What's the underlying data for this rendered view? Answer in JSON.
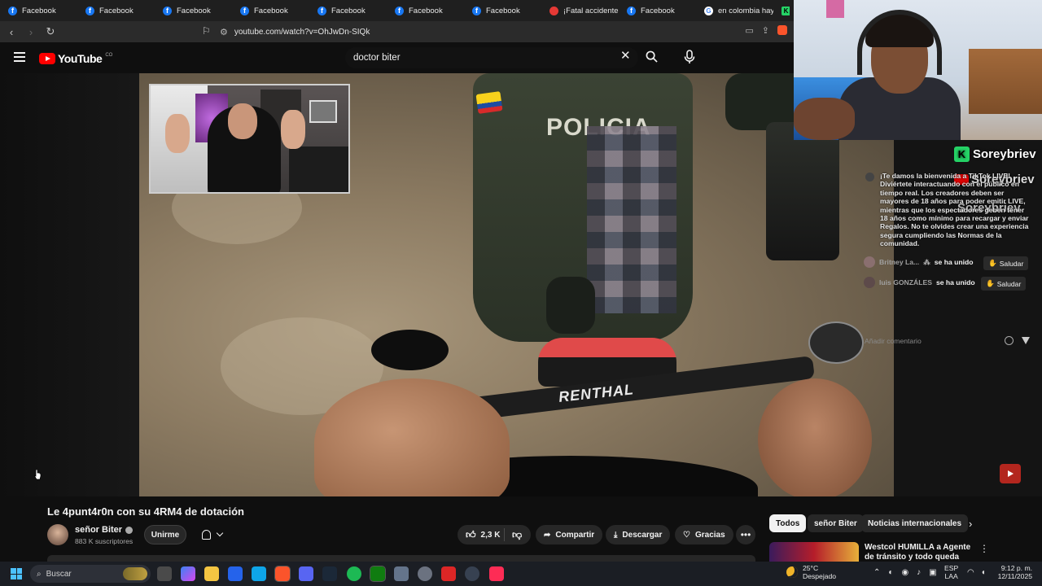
{
  "browser": {
    "tabs": [
      {
        "title": "Facebook",
        "icon": "facebook-icon"
      },
      {
        "title": "Facebook",
        "icon": "facebook-icon"
      },
      {
        "title": "Facebook",
        "icon": "facebook-icon"
      },
      {
        "title": "Facebook",
        "icon": "facebook-icon"
      },
      {
        "title": "Facebook",
        "icon": "facebook-icon"
      },
      {
        "title": "Facebook",
        "icon": "facebook-icon"
      },
      {
        "title": "Facebook",
        "icon": "facebook-icon"
      },
      {
        "title": "¡Fatal accidente!",
        "icon": "news-icon"
      },
      {
        "title": "Facebook",
        "icon": "facebook-icon"
      },
      {
        "title": "en colombia hay",
        "icon": "google-icon"
      },
      {
        "title": "",
        "icon": "kick-icon"
      }
    ],
    "url": "youtube.com/watch?v=OhJwDn-SIQk"
  },
  "youtube": {
    "logo_text": "YouTube",
    "country_code": "CO",
    "search_query": "doctor biter",
    "video": {
      "title": "Le 4punt4r0n con su 4RM4 de dotación",
      "vest_text": "POLICIA",
      "handlebar_text": "RENTHAL",
      "channel": {
        "name": "señor Biter",
        "subscribers": "883 K suscriptores",
        "join_label": "Unirme"
      },
      "actions": {
        "likes": "2,3 K",
        "share": "Compartir",
        "download": "Descargar",
        "thanks": "Gracias"
      }
    },
    "chips": [
      "Todos",
      "señor Biter",
      "Noticias internacionales"
    ],
    "recommendation": {
      "title": "Westcol HUMILLA a Agente de tránsito y todo queda Grabado"
    }
  },
  "stream_overlay": {
    "streamer_name": "Soreybriev",
    "welcome_message": "¡Te damos la bienvenida a TikTok LIVE! Diviértete interactuando con el público en tiempo real. Los creadores deben ser mayores de 18 años para poder emitir LIVE, mientras que los espectadores deben tener 18 años como mínimo para recargar y enviar Regalos. No te olvides crear una experiencia segura cumpliendo las Normas de la comunidad.",
    "events": [
      {
        "user": "Britney La...",
        "action": "se ha unido",
        "button": "Saludar"
      },
      {
        "user": "luis GONZÁLES",
        "action": "se ha unido",
        "button": "Saludar"
      }
    ],
    "comment_placeholder": "Añadir comentario"
  },
  "taskbar": {
    "search_label": "Buscar",
    "weather": {
      "temp": "25°C",
      "desc": "Despejado"
    },
    "language": {
      "lang": "ESP",
      "layout": "LAA"
    },
    "time": "9:12 p. m.",
    "date": "12/11/2025"
  },
  "colors": {
    "youtube_red": "#ff0000",
    "kick_green": "#25d366",
    "facebook_blue": "#1877f2",
    "background": "#0f0f0f"
  }
}
